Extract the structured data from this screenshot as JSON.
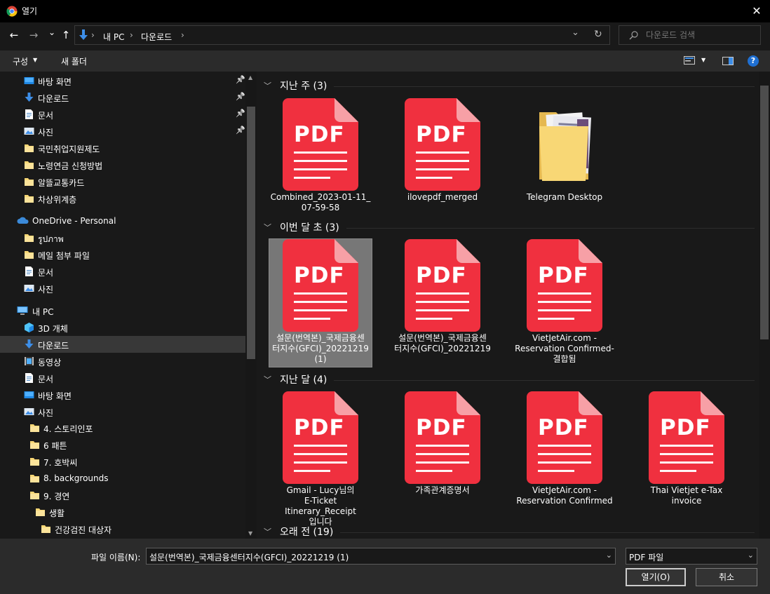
{
  "window": {
    "title": "열기",
    "close_glyph": "✕"
  },
  "nav": {
    "back_glyph": "←",
    "forward_glyph": "→",
    "recent_glyph": "⌄",
    "up_glyph": "↑",
    "breadcrumb": [
      "내 PC",
      "다운로드"
    ],
    "separator": "›",
    "address_dropdown_glyph": "⌄",
    "refresh_glyph": "↻",
    "search_placeholder": "다운로드 검색"
  },
  "toolbar": {
    "organize": "구성",
    "new_folder": "새 폴더",
    "help": "?"
  },
  "sidebar": {
    "quick_access": [
      {
        "label": "바탕 화면",
        "icon": "desktop",
        "pinned": true
      },
      {
        "label": "다운로드",
        "icon": "download",
        "pinned": true
      },
      {
        "label": "문서",
        "icon": "document",
        "pinned": true
      },
      {
        "label": "사진",
        "icon": "pictures",
        "pinned": true
      },
      {
        "label": "국민취업지원제도",
        "icon": "folder",
        "pinned": false
      },
      {
        "label": "노령연금 신청방법",
        "icon": "folder",
        "pinned": false
      },
      {
        "label": "알뜰교통카드",
        "icon": "folder",
        "pinned": false
      },
      {
        "label": "차상위계층",
        "icon": "folder",
        "pinned": false
      }
    ],
    "onedrive": {
      "label": "OneDrive - Personal",
      "items": [
        {
          "label": "รูปภาพ",
          "icon": "folder"
        },
        {
          "label": "메일 첨부 파일",
          "icon": "folder"
        },
        {
          "label": "문서",
          "icon": "document"
        },
        {
          "label": "사진",
          "icon": "pictures"
        }
      ]
    },
    "this_pc": {
      "label": "내 PC",
      "items": [
        {
          "label": "3D 개체",
          "icon": "3d"
        },
        {
          "label": "다운로드",
          "icon": "download",
          "selected": true
        },
        {
          "label": "동영상",
          "icon": "video"
        },
        {
          "label": "문서",
          "icon": "document"
        },
        {
          "label": "바탕 화면",
          "icon": "desktop"
        },
        {
          "label": "사진",
          "icon": "pictures"
        }
      ],
      "sub_items": [
        {
          "label": "4. 스토리인포",
          "level": 1
        },
        {
          "label": "6 패튼",
          "level": 1
        },
        {
          "label": "7. 호박씨",
          "level": 1
        },
        {
          "label": "8. backgrounds",
          "level": 1
        },
        {
          "label": "9. 경연",
          "level": 1
        },
        {
          "label": "생활",
          "level": 2
        },
        {
          "label": "건강검진 대상자",
          "level": 3
        }
      ]
    }
  },
  "groups": [
    {
      "label": "지난 주 (3)",
      "files": [
        {
          "name": "Combined_2023-01-11_\n07-59-58",
          "type": "pdf"
        },
        {
          "name": "ilovepdf_merged",
          "type": "pdf"
        },
        {
          "name": "Telegram Desktop",
          "type": "folder"
        }
      ]
    },
    {
      "label": "이번 달 초 (3)",
      "files": [
        {
          "name": "설문(번역본)_국제금융센\n터지수(GFCI)_20221219\n(1)",
          "type": "pdf",
          "selected": true
        },
        {
          "name": "설문(번역본)_국제금융센\n터지수(GFCI)_20221219",
          "type": "pdf"
        },
        {
          "name": "VietJetAir.com -\nReservation Confirmed-\n결합됨",
          "type": "pdf"
        }
      ]
    },
    {
      "label": "지난 달 (4)",
      "files": [
        {
          "name": "Gmail - Lucy님의\nE-Ticket Itinerary_Receipt\n입니다",
          "type": "pdf"
        },
        {
          "name": "가족관계증명서",
          "type": "pdf"
        },
        {
          "name": "VietJetAir.com -\nReservation Confirmed",
          "type": "pdf"
        },
        {
          "name": "Thai Vietjet e-Tax\ninvoice",
          "type": "pdf"
        }
      ]
    },
    {
      "label": "오래 전 (19)",
      "files": []
    }
  ],
  "pdf_badge": "PDF",
  "footer": {
    "filename_label": "파일 이름(N):",
    "filename_value": "설문(번역본)_국제금융센터지수(GFCI)_20221219 (1)",
    "filetype_value": "PDF 파일",
    "open_button": "열기(O)",
    "cancel_button": "취소"
  },
  "colors": {
    "pdf_red": "#f0303f",
    "pdf_fold": "#f7a0a6",
    "folder_yellow": "#f8d775",
    "selection": "#777777",
    "onedrive_blue": "#3b8ad9",
    "download_blue": "#3d8ee8"
  }
}
